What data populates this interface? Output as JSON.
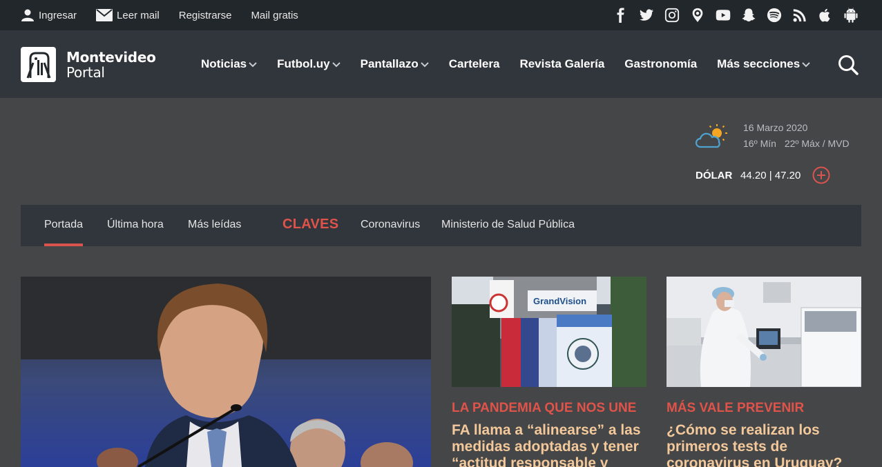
{
  "topbar": {
    "links": [
      {
        "label": "Ingresar",
        "icon": "user-icon"
      },
      {
        "label": "Leer mail",
        "icon": "mail-icon"
      },
      {
        "label": "Registrarse"
      },
      {
        "label": "Mail gratis"
      }
    ],
    "social": [
      "facebook-icon",
      "twitter-icon",
      "instagram-icon",
      "periscope-icon",
      "youtube-icon",
      "snapchat-icon",
      "spotify-icon",
      "rss-icon",
      "apple-icon",
      "android-icon"
    ]
  },
  "header": {
    "logo_line1": "Montevideo",
    "logo_line2": "Portal",
    "nav": [
      {
        "label": "Noticias",
        "dropdown": true
      },
      {
        "label": "Futbol.uy",
        "dropdown": true
      },
      {
        "label": "Pantallazo",
        "dropdown": true
      },
      {
        "label": "Cartelera",
        "dropdown": false
      },
      {
        "label": "Revista Galería",
        "dropdown": false
      },
      {
        "label": "Gastronomía",
        "dropdown": false
      },
      {
        "label": "Más secciones",
        "dropdown": true
      }
    ]
  },
  "weather": {
    "date": "16 Marzo 2020",
    "min": "16º Mín",
    "max": "22º Máx / MVD"
  },
  "currency": {
    "label": "DÓLAR",
    "values": "44.20 | 47.20"
  },
  "tabs": {
    "items": [
      "Portada",
      "Última hora",
      "Más leídas"
    ],
    "active": "Portada",
    "claves_label": "CLAVES",
    "claves": [
      "Coronavirus",
      "Ministerio de Salud Pública"
    ]
  },
  "articles": [
    {
      "kicker": "LA PANDEMIA QUE NOS UNE",
      "title": "FA llama a “alinearse” a las medidas adoptadas y tener “actitud responsable y"
    },
    {
      "kicker": "MÁS VALE PREVENIR",
      "title": "¿Cómo se realizan los primeros tests de coronavirus en Uruguay?"
    }
  ],
  "colors": {
    "accent": "#e0534a",
    "headline": "#f3c99c",
    "topbar_bg": "#22272c",
    "header_bg": "#30363b",
    "page_bg": "#454647"
  }
}
